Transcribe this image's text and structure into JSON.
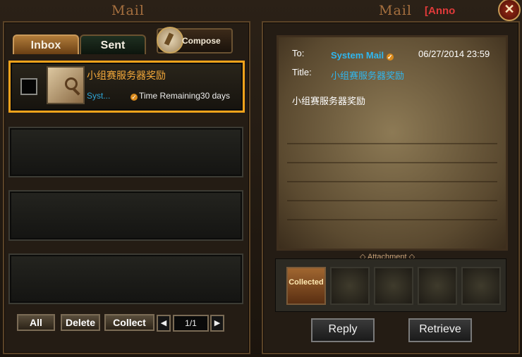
{
  "window": {
    "title_left": "Mail",
    "title_right": "Mail",
    "announcement": "[Anno"
  },
  "tabs": [
    {
      "label": "Inbox"
    },
    {
      "label": "Sent"
    }
  ],
  "compose": {
    "label": "Compose"
  },
  "inbox": {
    "items": [
      {
        "subject": "小组赛服务器奖励",
        "sender": "Syst...",
        "time_remaining": "Time Remaining30 days"
      }
    ]
  },
  "list_buttons": {
    "all": "All",
    "delete": "Delete",
    "collect": "Collect",
    "page": "1/1"
  },
  "message": {
    "to_label": "To:",
    "to_value": "System Mail",
    "date": "06/27/2014 23:59",
    "title_label": "Title:",
    "title_value": "小组赛服务器奖励",
    "body": "小组赛服务器奖励"
  },
  "attachment": {
    "label": "Attachment",
    "slot1_status": "Collected"
  },
  "actions": {
    "reply": "Reply",
    "retrieve": "Retrieve"
  },
  "colors": {
    "accent_orange": "#f3a31b",
    "link_blue": "#2fb7f0",
    "title_gold": "#a6703f"
  }
}
